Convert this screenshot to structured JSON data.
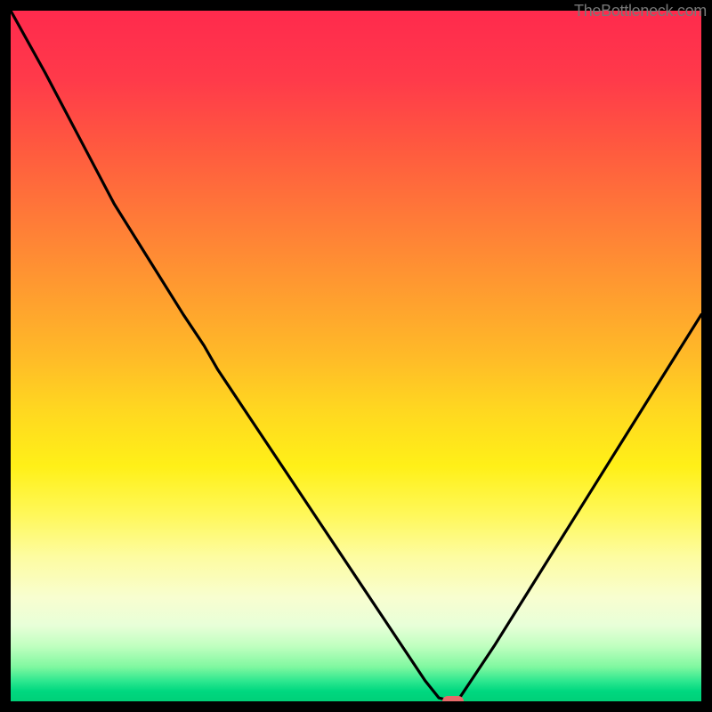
{
  "attribution": "TheBottleneck.com",
  "chart_data": {
    "type": "line",
    "title": "",
    "xlabel": "",
    "ylabel": "",
    "x": [
      0,
      5,
      10,
      15,
      20,
      25,
      28,
      30,
      35,
      40,
      45,
      50,
      55,
      60,
      62,
      64,
      65,
      70,
      75,
      80,
      85,
      90,
      95,
      100
    ],
    "values": [
      100,
      91,
      81.5,
      72,
      64,
      56,
      51.5,
      48,
      40.5,
      33,
      25.5,
      18,
      10.5,
      3,
      0.5,
      0,
      0.5,
      8,
      16,
      24,
      32,
      40,
      48,
      56
    ],
    "xlim": [
      0,
      100
    ],
    "ylim": [
      0,
      100
    ],
    "marker": {
      "x": 64,
      "y": 0
    },
    "gradient_stops": [
      {
        "pct": 0,
        "color": "#ff2a4d"
      },
      {
        "pct": 50,
        "color": "#ffba28"
      },
      {
        "pct": 73,
        "color": "#fff85a"
      },
      {
        "pct": 92,
        "color": "#c0ffc0"
      },
      {
        "pct": 100,
        "color": "#00d078"
      }
    ]
  }
}
